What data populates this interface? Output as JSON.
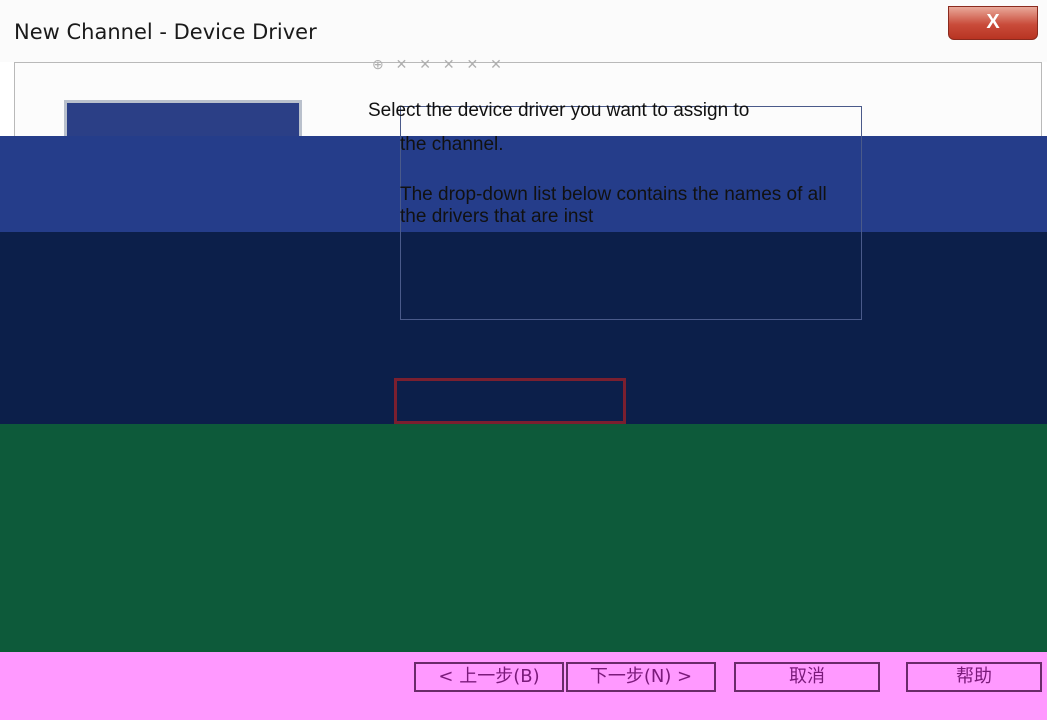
{
  "window": {
    "title": "New Channel - Device Driver",
    "close_label": "X"
  },
  "content": {
    "instruction_1": "Select the device driver you want to assign to",
    "instruction_2": "the channel.",
    "instruction_3": "The drop-down list below contains the names of all the drivers that are inst"
  },
  "buttons": {
    "back": "< 上一步(B)",
    "next": "下一步(N) >",
    "cancel": "取消",
    "help": "帮助"
  },
  "colors": {
    "glitch_blue": "#0c1f4a",
    "glitch_green": "#0d5a3a",
    "glitch_magenta": "#ff99ff"
  }
}
